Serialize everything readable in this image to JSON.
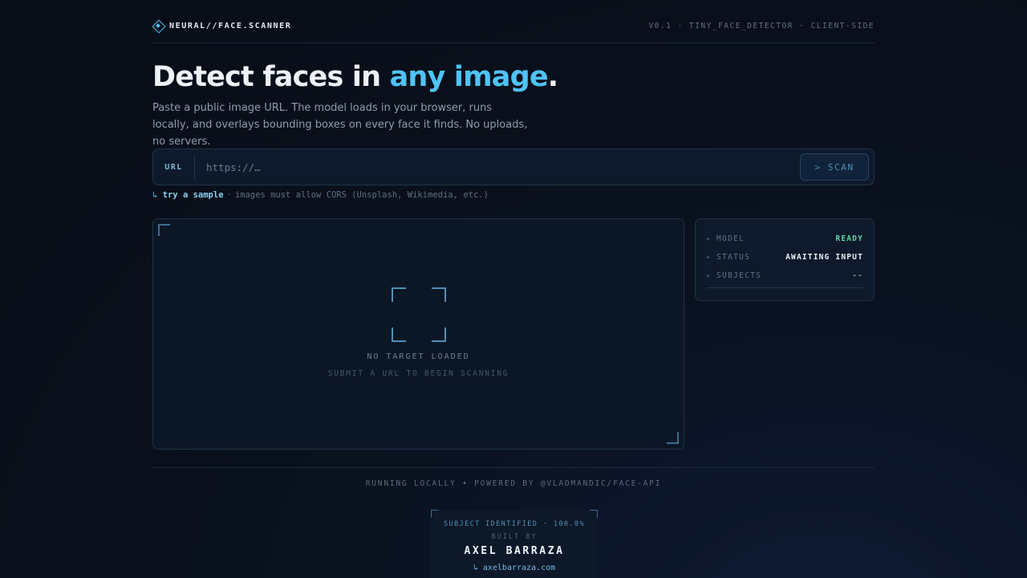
{
  "header": {
    "brand": "NEURAL//FACE.SCANNER",
    "meta": "V0.1 · TINY_FACE_DETECTOR · CLIENT-SIDE"
  },
  "hero": {
    "title_main": "Detect faces in ",
    "title_accent": "any image",
    "title_end": ".",
    "subtitle": "Paste a public image URL. The model loads in your browser, runs locally, and overlays bounding boxes on every face it finds. No uploads, no servers."
  },
  "url_bar": {
    "label": "URL",
    "placeholder": "https://…",
    "value": "",
    "button_label": "> SCAN"
  },
  "hint": {
    "arrow": "↳",
    "sample_link": "try a sample",
    "separator": "·",
    "note": "images must allow CORS (Unsplash, Wikimedia, etc.)"
  },
  "viewer": {
    "empty_title": "NO TARGET LOADED",
    "empty_subtitle": "SUBMIT A URL TO BEGIN SCANNING"
  },
  "stats": [
    {
      "key": "MODEL",
      "value": "READY"
    },
    {
      "key": "STATUS",
      "value": "AWAITING INPUT"
    },
    {
      "key": "SUBJECTS",
      "value": "--"
    }
  ],
  "stat_bullet": "▸",
  "footer": {
    "text": "RUNNING LOCALLY • POWERED BY @VLADMANDIC/FACE-API"
  },
  "credit": {
    "line1": "SUBJECT IDENTIFIED · 100.0%",
    "line2": "BUILT BY",
    "name": "AXEL BARRAZA",
    "link": "↳ axelbarraza.com"
  },
  "colors": {
    "accent": "#4fc3f7",
    "ready": "#5fd4a0",
    "background": "#080d16"
  }
}
